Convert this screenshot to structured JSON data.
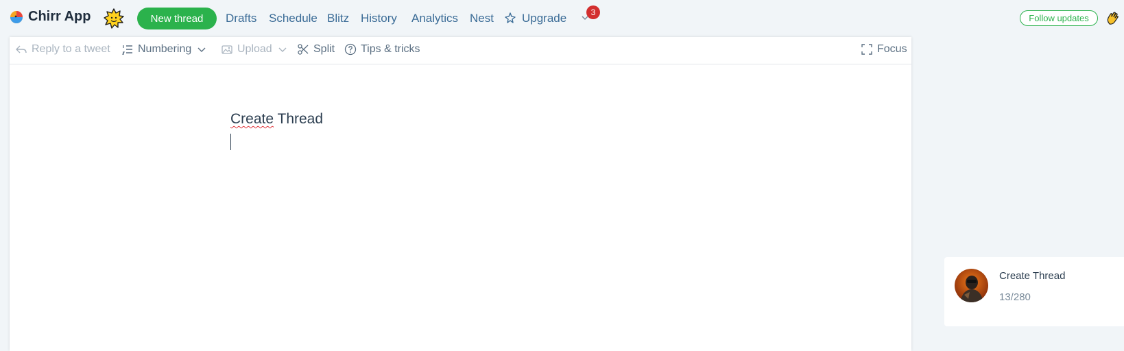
{
  "app": {
    "name": "Chirr App"
  },
  "nav": {
    "new_thread": "New thread",
    "links": [
      "Drafts",
      "Schedule",
      "Blitz",
      "History",
      "Analytics",
      "Nest",
      "Upgrade"
    ],
    "notification_count": "3",
    "follow_updates": "Follow updates"
  },
  "toolbar": {
    "reply": "Reply to a tweet",
    "numbering": "Numbering",
    "upload": "Upload",
    "split": "Split",
    "tips": "Tips & tricks",
    "focus": "Focus"
  },
  "editor": {
    "word1": "Create",
    "word2": "Thread"
  },
  "preview": {
    "text": "Create Thread",
    "count": "13/280"
  },
  "colors": {
    "accent_green": "#2bb24c",
    "link_blue": "#3a6b96",
    "badge_red": "#d32f2f",
    "background": "#f1f5f8"
  }
}
